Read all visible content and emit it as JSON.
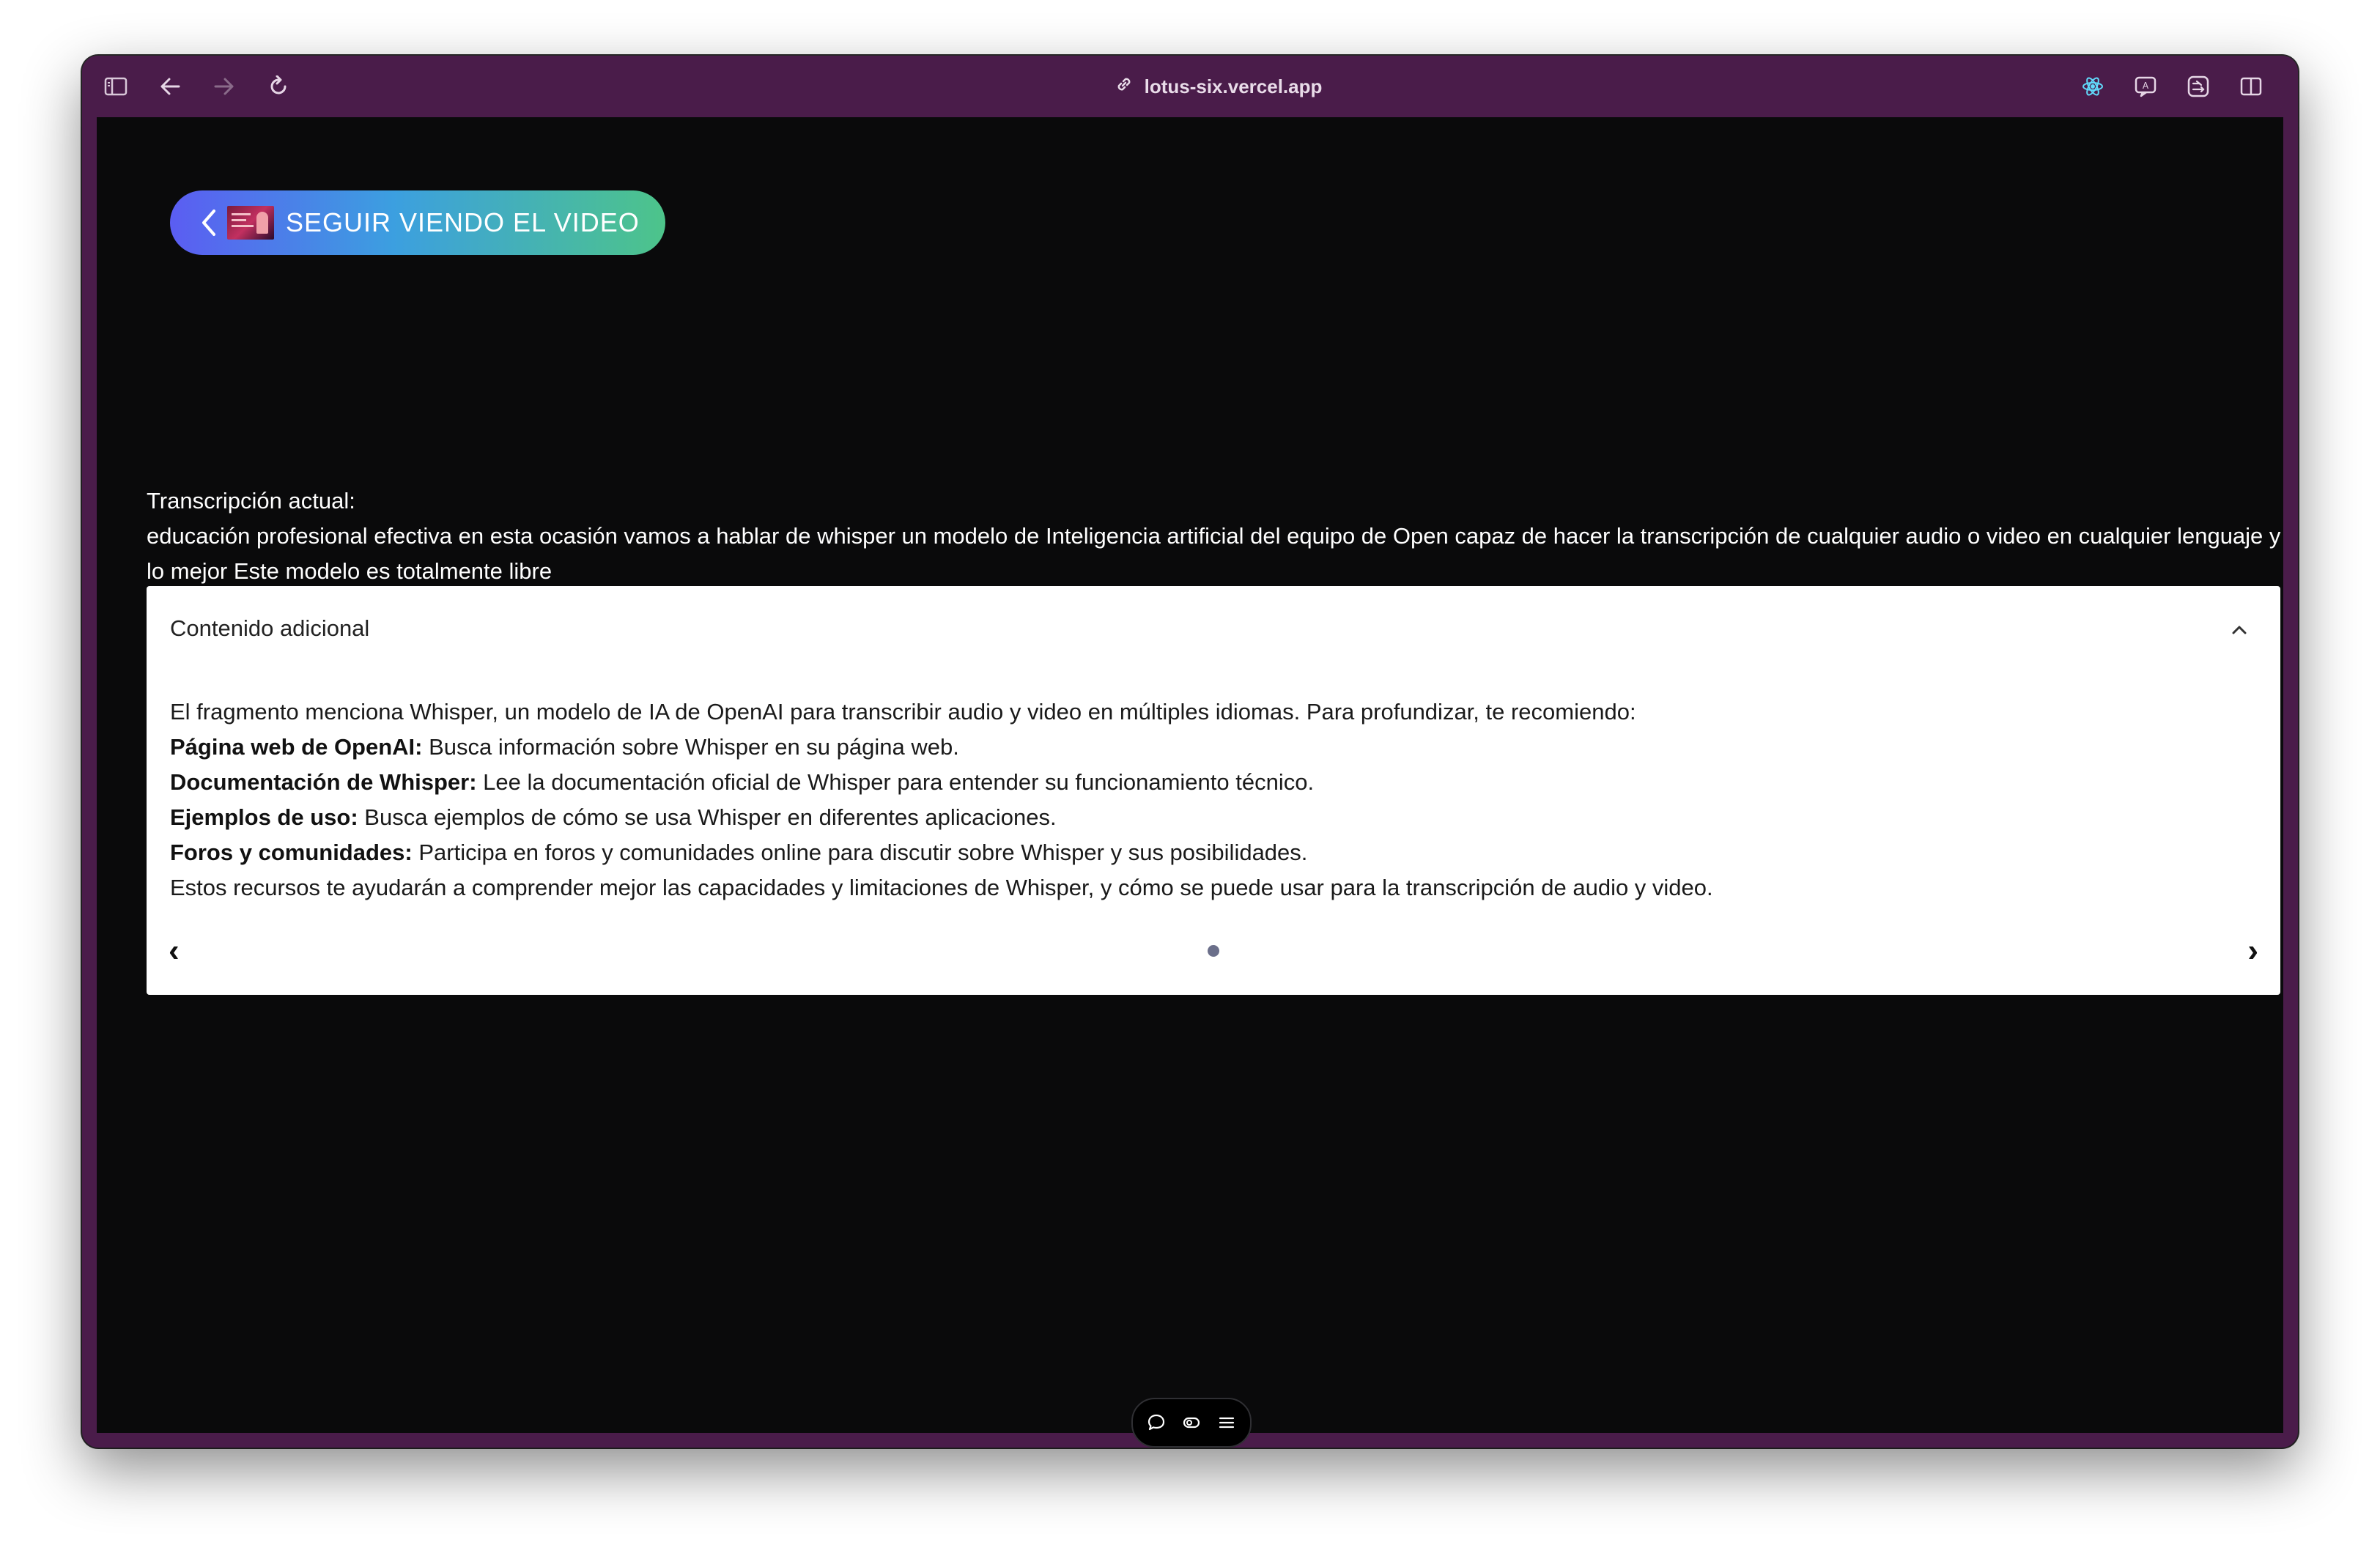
{
  "browser": {
    "url": "lotus-six.vercel.app",
    "icons": [
      "sidebar-icon",
      "back-arrow-icon",
      "forward-arrow-icon",
      "reload-icon",
      "link-icon",
      "react-devtools-icon",
      "translate-icon",
      "extension-icon",
      "split-view-icon"
    ]
  },
  "back_button": {
    "label": "SEGUIR VIENDO EL VIDEO",
    "gradient": [
      "#5b5df2",
      "#3c9fe0",
      "#4dc48a"
    ]
  },
  "transcript": {
    "title": "Transcripción actual:",
    "text": "educación profesional efectiva en esta ocasión vamos a hablar de whisper un modelo de Inteligencia artificial del equipo de Open capaz de hacer la transcripción de cualquier audio o video en cualquier lenguaje y lo mejor Este modelo es totalmente libre"
  },
  "card": {
    "header": "Contenido adicional",
    "intro": "El fragmento menciona Whisper, un modelo de IA de OpenAI para transcribir audio y video en múltiples idiomas. Para profundizar, te recomiendo:",
    "items": [
      {
        "title": "Página web de OpenAI:",
        "text": " Busca información sobre Whisper en su página web."
      },
      {
        "title": "Documentación de Whisper:",
        "text": " Lee la documentación oficial de Whisper para entender su funcionamiento técnico."
      },
      {
        "title": "Ejemplos de uso:",
        "text": " Busca ejemplos de cómo se usa Whisper en diferentes aplicaciones."
      },
      {
        "title": "Foros y comunidades:",
        "text": " Participa en foros y comunidades online para discutir sobre Whisper y sus posibilidades."
      }
    ],
    "outro": "Estos recursos te ayudarán a comprender mejor las capacidades y limitaciones de Whisper, y cómo se puede usar para la transcripción de audio y video.",
    "prev": "‹",
    "next": "›"
  },
  "floating_bar": {
    "icons": [
      "chat-bubble-icon",
      "eye-toggle-icon",
      "menu-icon"
    ]
  },
  "colors": {
    "toolbar": "#4a1c4a",
    "page_background": "#0a0a0b",
    "card_background": "#ffffff",
    "dot": "#6b6f8a"
  }
}
